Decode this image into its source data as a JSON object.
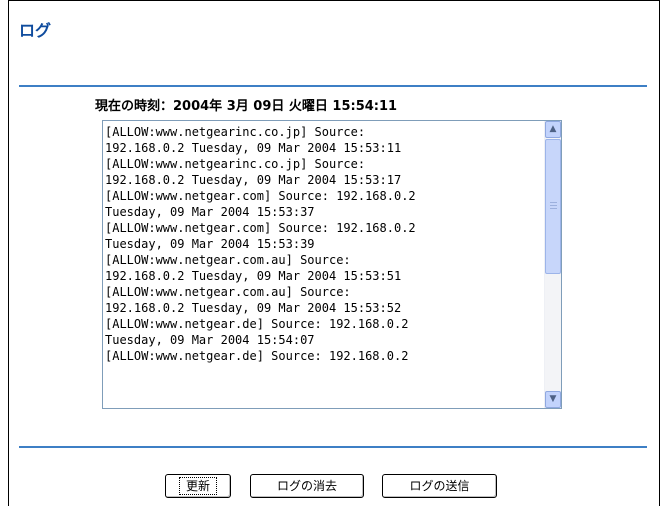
{
  "page": {
    "title": "ログ"
  },
  "time": {
    "label": "現在の時刻：2004年 3月 09日 火曜日 15:54:11"
  },
  "log": {
    "text": "[ALLOW:www.netgearinc.co.jp] Source:\n192.168.0.2 Tuesday, 09 Mar 2004 15:53:11\n[ALLOW:www.netgearinc.co.jp] Source:\n192.168.0.2 Tuesday, 09 Mar 2004 15:53:17\n[ALLOW:www.netgear.com] Source: 192.168.0.2\nTuesday, 09 Mar 2004 15:53:37\n[ALLOW:www.netgear.com] Source: 192.168.0.2\nTuesday, 09 Mar 2004 15:53:39\n[ALLOW:www.netgear.com.au] Source:\n192.168.0.2 Tuesday, 09 Mar 2004 15:53:51\n[ALLOW:www.netgear.com.au] Source:\n192.168.0.2 Tuesday, 09 Mar 2004 15:53:52\n[ALLOW:www.netgear.de] Source: 192.168.0.2\nTuesday, 09 Mar 2004 15:54:07\n[ALLOW:www.netgear.de] Source: 192.168.0.2"
  },
  "buttons": {
    "refresh": "更新",
    "clear_log": "ログの消去",
    "send_log": "ログの送信"
  },
  "icons": {
    "scroll_up": "chevron-up-icon",
    "scroll_down": "chevron-down-icon"
  },
  "colors": {
    "title": "#0f4c9e",
    "rule": "#3d7fc5",
    "scrollbar": "#c2d3fc"
  }
}
